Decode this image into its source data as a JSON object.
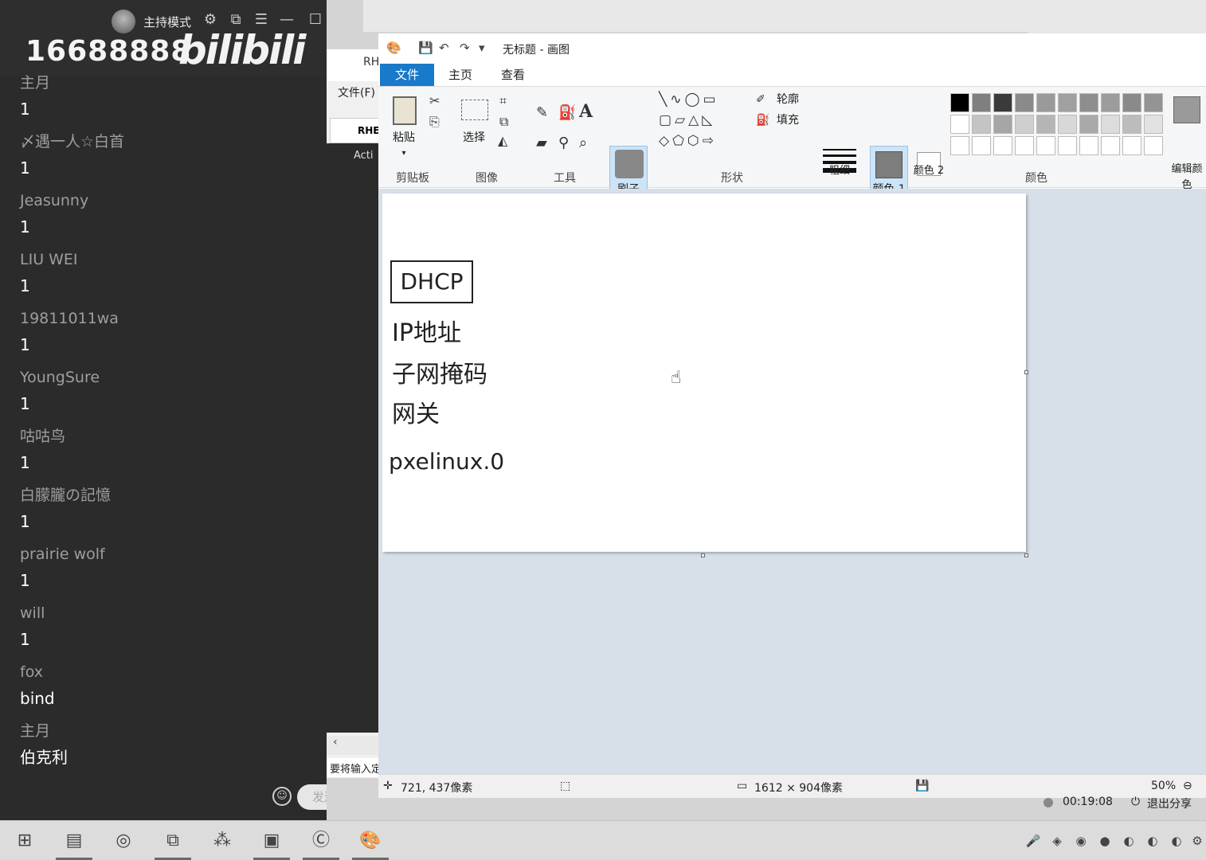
{
  "chat": {
    "room_id": "16688888",
    "logo": "bilibili",
    "host_mode_label": "主持模式",
    "messages": [
      {
        "user": "主月",
        "text": "1"
      },
      {
        "user": "〆遇一人☆白首",
        "text": "1"
      },
      {
        "user": "Jeasunny",
        "text": "1"
      },
      {
        "user": "LIU WEI",
        "text": "1"
      },
      {
        "user": "19811011wa",
        "text": "1"
      },
      {
        "user": "YoungSure",
        "text": "1"
      },
      {
        "user": "咕咕鸟",
        "text": "1"
      },
      {
        "user": "白朦朧の記憶",
        "text": "1"
      },
      {
        "user": "prairie wolf",
        "text": "1"
      },
      {
        "user": "will",
        "text": "1"
      },
      {
        "user": "fox",
        "text": "bind"
      },
      {
        "user": "主月",
        "text": "伯克利"
      }
    ],
    "send_label": "发送"
  },
  "bg_window": {
    "title": "RH",
    "file_menu": "文件(F)",
    "tab": "RHE",
    "item": "Acti",
    "status": "要将输入定"
  },
  "paint": {
    "title": "无标题 - 画图",
    "tabs": {
      "file": "文件",
      "home": "主页",
      "view": "查看"
    },
    "ribbon": {
      "paste": "粘贴",
      "select": "选择",
      "brush": "刷子",
      "outline": "轮廓",
      "fill": "填充",
      "thickness": "粗细",
      "color1": "颜色 1",
      "color2": "颜色 2",
      "edit_colors": "编辑颜色",
      "groups": {
        "clipboard": "剪贴板",
        "image": "图像",
        "tools": "工具",
        "shapes": "形状",
        "colors": "颜色"
      }
    },
    "palette": [
      "#000000",
      "#7f7f7f",
      "#3a3a3a",
      "#8a8a8a",
      "#9a9a9a",
      "#a0a0a0",
      "#8e8e8e",
      "#9c9c9c",
      "#8a8a8a",
      "#949494",
      "#ffffff",
      "#c4c4c4",
      "#a6a6a6",
      "#cfcfcf",
      "#b5b5b5",
      "#d8d8d8",
      "#a9a9a9",
      "#dcdcdc",
      "#bcbcbc",
      "#e2e2e2",
      "#ffffff",
      "#ffffff",
      "#ffffff",
      "#ffffff",
      "#ffffff",
      "#ffffff",
      "#ffffff",
      "#ffffff",
      "#ffffff",
      "#ffffff"
    ],
    "canvas_texts": {
      "dhcp": "DHCP",
      "ip": "IP地址",
      "mask": "子网掩码",
      "gateway": "网关",
      "pxe": "pxelinux.0"
    },
    "status": {
      "cursor_pos": "721, 437像素",
      "canvas_size": "1612 × 904像素",
      "zoom": "50%"
    }
  },
  "share": {
    "timer": "00:19:08",
    "exit_label": "退出分享"
  }
}
